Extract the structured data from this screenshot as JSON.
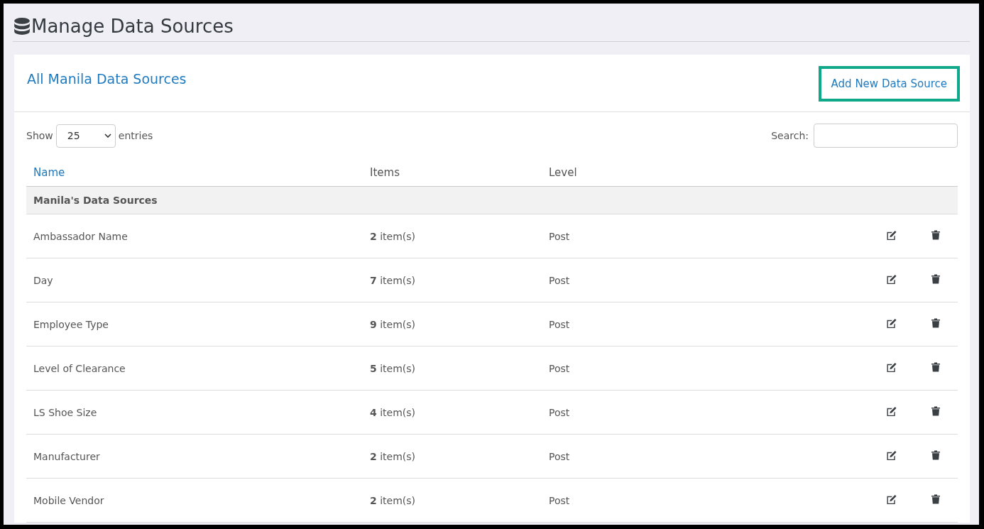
{
  "page": {
    "title": "Manage Data Sources"
  },
  "card": {
    "title": "All Manila Data Sources",
    "add_button": "Add New Data Source"
  },
  "length_control": {
    "label_before": "Show",
    "value": "25",
    "label_after": "entries"
  },
  "search": {
    "label": "Search:"
  },
  "table": {
    "columns": [
      "Name",
      "Items",
      "Level"
    ],
    "group": "Manila's Data Sources",
    "rows": [
      {
        "name": "Ambassador Name",
        "items": "**2** item(s)",
        "level": "Post"
      },
      {
        "name": "Day",
        "items": "**7** item(s)",
        "level": "Post"
      },
      {
        "name": "Employee Type",
        "items": "**9** item(s)",
        "level": "Post"
      },
      {
        "name": "Level of Clearance",
        "items": "**5** item(s)",
        "level": "Post"
      },
      {
        "name": "LS Shoe Size",
        "items": "**4** item(s)",
        "level": "Post"
      },
      {
        "name": "Manufacturer",
        "items": "**2** item(s)",
        "level": "Post"
      },
      {
        "name": "Mobile Vendor",
        "items": "**2** item(s)",
        "level": "Post"
      }
    ]
  }
}
